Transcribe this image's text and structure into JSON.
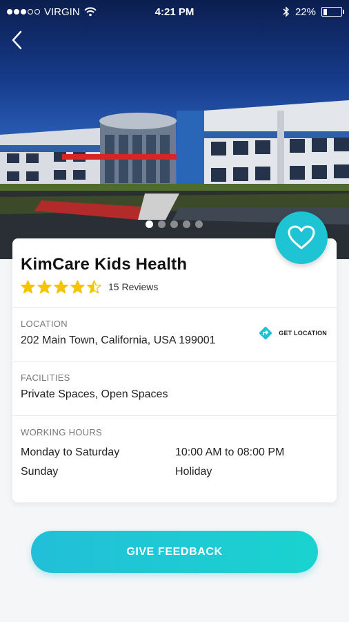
{
  "status_bar": {
    "carrier": "VIRGIN",
    "time": "4:21 PM",
    "battery": "22%",
    "battery_level": 0.22
  },
  "hero": {
    "image_count": 5,
    "active_index": 0
  },
  "clinic": {
    "name": "KimCare Kids Health",
    "rating": 4.5,
    "reviews": "15 Reviews"
  },
  "location": {
    "label": "LOCATION",
    "address": "202 Main Town, California, USA 199001",
    "action": "GET LOCATION"
  },
  "facilities": {
    "label": "FACILITIES",
    "value": "Private Spaces, Open Spaces"
  },
  "working_hours": {
    "label": "WORKING HOURS",
    "rows": [
      {
        "days": "Monday to Saturday",
        "hours": "10:00 AM to 08:00 PM"
      },
      {
        "days": "Sunday",
        "hours": "Holiday"
      }
    ]
  },
  "feedback_button": "GIVE FEEDBACK",
  "colors": {
    "accent": "#1ec4d4",
    "star": "#f2c500"
  }
}
